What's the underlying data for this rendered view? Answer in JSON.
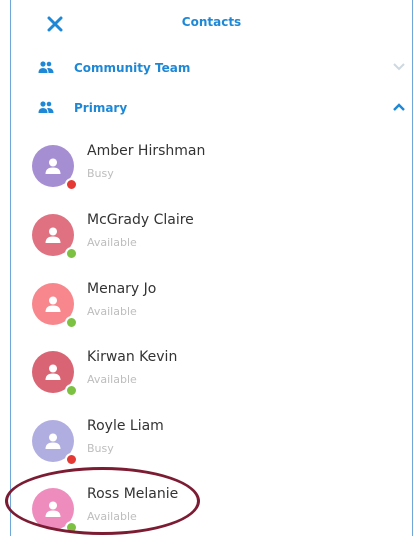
{
  "header": {
    "title": "Contacts",
    "close_icon": "close-icon"
  },
  "groups": [
    {
      "label": "Community Team",
      "icon": "people-icon",
      "expanded": false,
      "chevron": "chevron-down-icon"
    },
    {
      "label": "Primary",
      "icon": "people-icon",
      "expanded": true,
      "chevron": "chevron-up-icon"
    }
  ],
  "contacts": [
    {
      "name": "Amber Hirshman",
      "status": "Busy",
      "avatar_color": "#a68ed3",
      "status_color": "#e53935"
    },
    {
      "name": "McGrady Claire",
      "status": "Available",
      "avatar_color": "#df7181",
      "status_color": "#7cc142"
    },
    {
      "name": "Menary Jo",
      "status": "Available",
      "avatar_color": "#f7878c",
      "status_color": "#7cc142"
    },
    {
      "name": "Kirwan Kevin",
      "status": "Available",
      "avatar_color": "#d96474",
      "status_color": "#7cc142"
    },
    {
      "name": "Royle Liam",
      "status": "Busy",
      "avatar_color": "#b0aee0",
      "status_color": "#e53935"
    },
    {
      "name": "Ross Melanie",
      "status": "Available",
      "avatar_color": "#ee8dbd",
      "status_color": "#7cc142"
    }
  ],
  "colors": {
    "accent": "#1e88d6",
    "highlight_ring": "#7b1c33"
  }
}
